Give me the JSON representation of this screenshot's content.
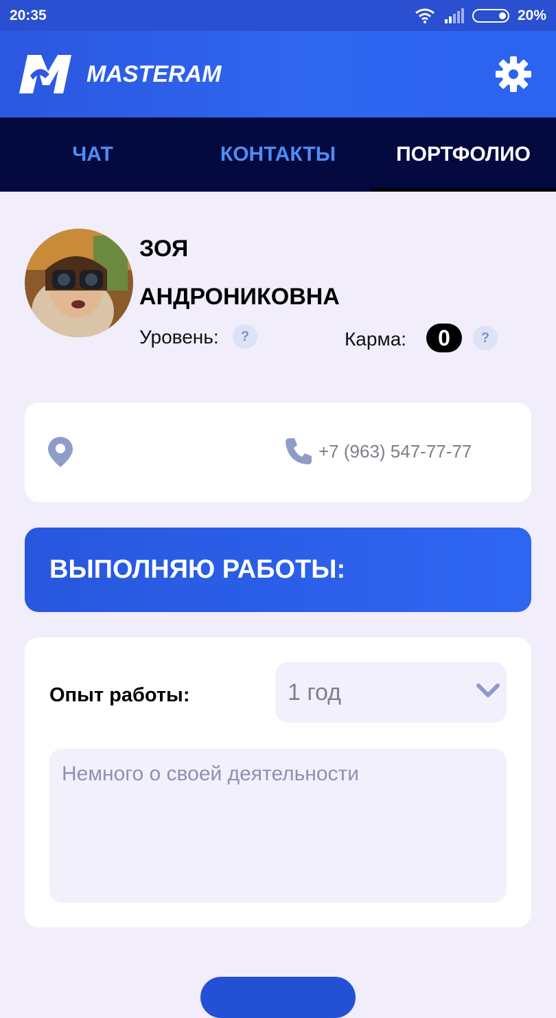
{
  "status_bar": {
    "time": "20:35",
    "battery": "20%"
  },
  "header": {
    "logo_text": "MASTERAM"
  },
  "tabs": [
    {
      "label": "ЧАТ",
      "active": false
    },
    {
      "label": "КОНТАКТЫ",
      "active": false
    },
    {
      "label": "ПОРТФОЛИО",
      "active": true
    }
  ],
  "profile": {
    "first_name": "ЗОЯ",
    "last_name": "АНДРОНИКОВНА",
    "level_label": "Уровень:",
    "karma_label": "Карма:",
    "karma_value": "0",
    "help_glyph": "?"
  },
  "contacts": {
    "phone": "+7 (963) 547-77-77"
  },
  "works": {
    "title": "ВЫПОЛНЯЮ РАБОТЫ:"
  },
  "experience": {
    "label": "Опыт работы:",
    "selected": "1 год",
    "about_placeholder": "Немного о своей деятельности"
  },
  "colors": {
    "primary": "#2e66f2",
    "tabs_bg": "#040a3f",
    "tab_inactive": "#4d8ef5",
    "page_bg": "#f1edfb",
    "icon_muted": "#8e9cc9"
  }
}
